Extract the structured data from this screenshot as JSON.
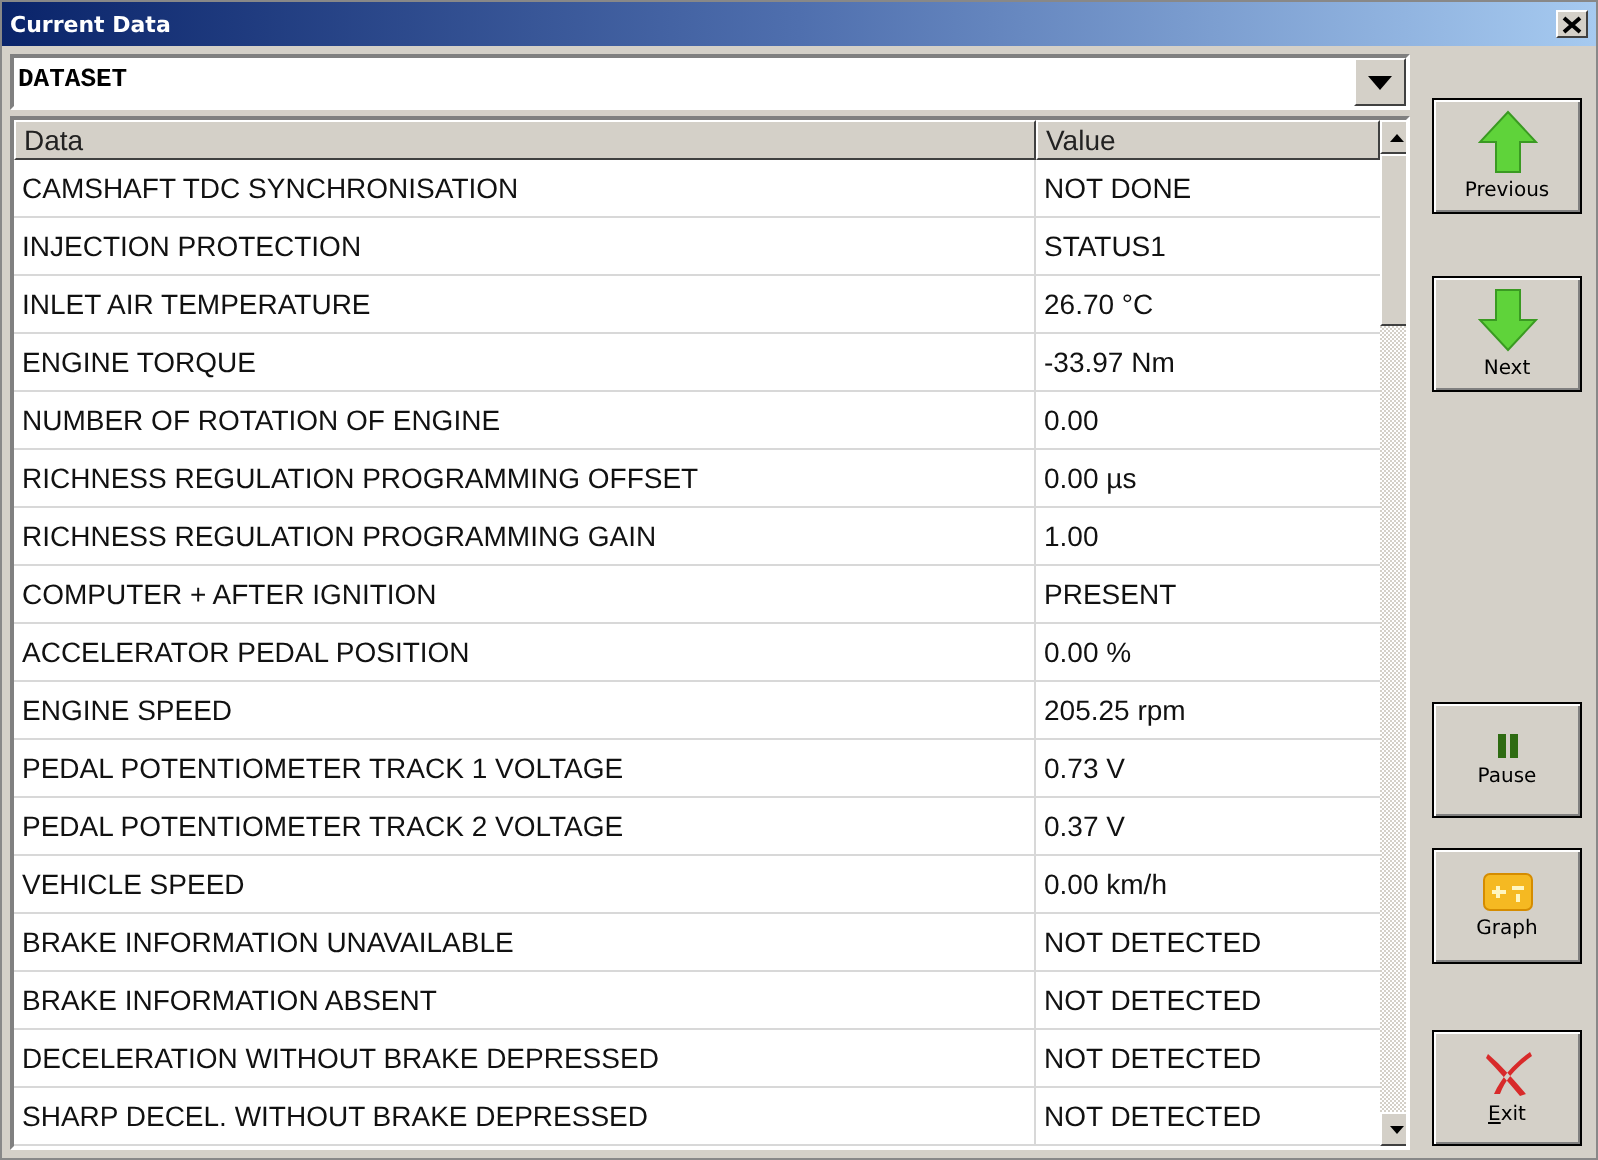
{
  "window": {
    "title": "Current Data"
  },
  "dropdown": {
    "value": "DATASET"
  },
  "table": {
    "columns": [
      "Data",
      "Value"
    ],
    "rows": [
      [
        "CAMSHAFT TDC SYNCHRONISATION",
        "NOT DONE"
      ],
      [
        "INJECTION PROTECTION",
        "STATUS1"
      ],
      [
        "INLET AIR TEMPERATURE",
        "26.70 °C"
      ],
      [
        "ENGINE TORQUE",
        "-33.97 Nm"
      ],
      [
        "NUMBER OF ROTATION OF ENGINE",
        "0.00"
      ],
      [
        "RICHNESS REGULATION PROGRAMMING OFFSET",
        "0.00 µs"
      ],
      [
        "RICHNESS REGULATION PROGRAMMING GAIN",
        "1.00"
      ],
      [
        "COMPUTER + AFTER IGNITION",
        "PRESENT"
      ],
      [
        "ACCELERATOR PEDAL POSITION",
        "0.00 %"
      ],
      [
        "ENGINE SPEED",
        "205.25 rpm"
      ],
      [
        "PEDAL POTENTIOMETER TRACK 1 VOLTAGE",
        "0.73 V"
      ],
      [
        "PEDAL POTENTIOMETER TRACK 2 VOLTAGE",
        "0.37 V"
      ],
      [
        "VEHICLE SPEED",
        "0.00 km/h"
      ],
      [
        "BRAKE INFORMATION UNAVAILABLE",
        "NOT DETECTED"
      ],
      [
        "BRAKE INFORMATION ABSENT",
        "NOT DETECTED"
      ],
      [
        "DECELERATION WITHOUT BRAKE DEPRESSED",
        "NOT DETECTED"
      ],
      [
        "SHARP DECEL. WITHOUT BRAKE DEPRESSED",
        "NOT DETECTED"
      ]
    ]
  },
  "buttons": [
    {
      "kind": "up",
      "label": "Previous"
    },
    {
      "kind": "down",
      "label": "Next"
    },
    {
      "kind": "pause",
      "label": "Pause"
    },
    {
      "kind": "graph",
      "label": "Graph"
    },
    {
      "kind": "exit",
      "label": "Exit"
    }
  ]
}
